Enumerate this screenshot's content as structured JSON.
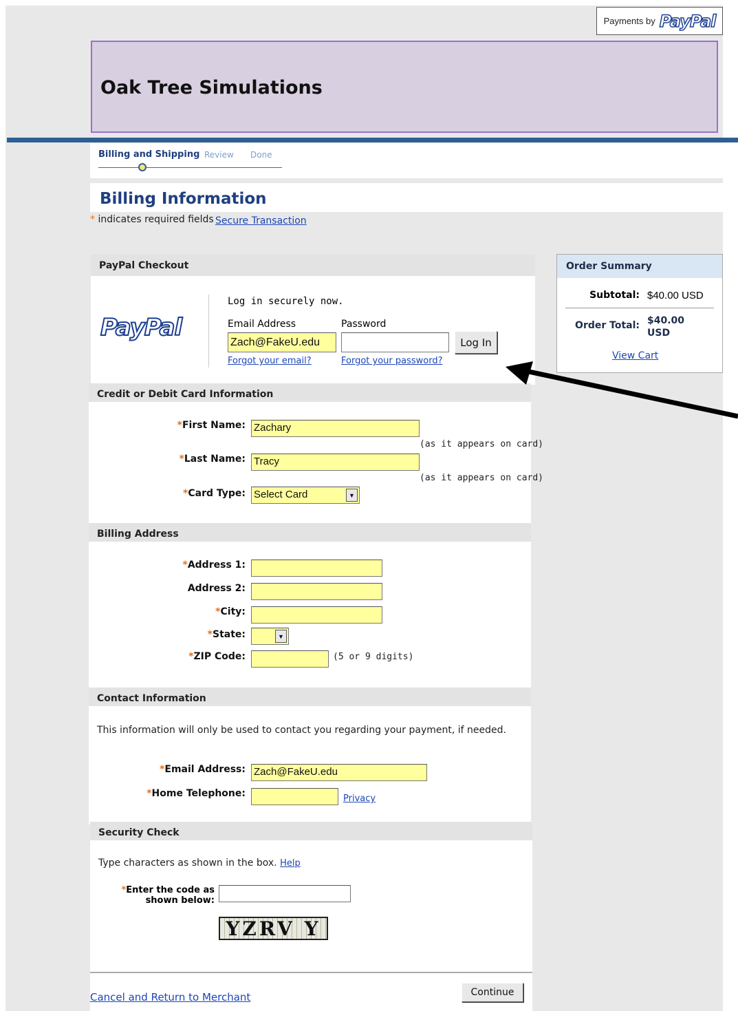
{
  "badge": {
    "prefix": "Payments by",
    "logo": "PayPal"
  },
  "merchant": {
    "name": "Oak Tree Simulations"
  },
  "steps": [
    {
      "label": "Billing and Shipping",
      "active": true
    },
    {
      "label": "Review"
    },
    {
      "label": "Done"
    }
  ],
  "billing": {
    "title": "Billing Information",
    "required_star": "*",
    "required_note": " indicates required fields",
    "secure_link": "Secure Transaction"
  },
  "paypal_checkout": {
    "header": "PayPal Checkout",
    "logo": "PayPal",
    "intro": "Log in securely now.",
    "email_label": "Email Address",
    "email_value": "Zach@FakeU.edu",
    "password_label": "Password",
    "password_value": "",
    "login_button": "Log In",
    "forgot_email": "Forgot your email?",
    "forgot_password": "Forgot your password?"
  },
  "card": {
    "header": "Credit or Debit Card Information",
    "first_name_label": "First Name:",
    "first_name_value": "Zachary",
    "last_name_label": "Last Name:",
    "last_name_value": "Tracy",
    "as_appears": "(as it appears on card)",
    "card_type_label": "Card Type:",
    "card_type_value": "Select Card"
  },
  "address": {
    "header": "Billing Address",
    "address1_label": "Address 1:",
    "address2_label": "Address 2:",
    "city_label": "City:",
    "state_label": "State:",
    "zip_label": "ZIP Code:",
    "zip_hint": "(5 or 9 digits)"
  },
  "contact": {
    "header": "Contact Information",
    "note": "This information will only be used to contact you regarding your payment, if needed.",
    "email_label": "Email Address:",
    "email_value": "Zach@FakeU.edu",
    "phone_label": "Home Telephone:",
    "privacy_link": "Privacy"
  },
  "security": {
    "header": "Security Check",
    "instruction": "Type characters as shown in the box.",
    "help_link": "Help",
    "code_label_1": "Enter the code as",
    "code_label_2": "shown below:",
    "captcha_text": "YZRV Y"
  },
  "footer": {
    "cancel_link": "Cancel and Return to Merchant",
    "continue_button": "Continue"
  },
  "order_summary": {
    "header": "Order Summary",
    "subtotal_label": "Subtotal:",
    "subtotal_value": "$40.00 USD",
    "total_label": "Order Total:",
    "total_value_1": "$40.00",
    "total_value_2": "USD",
    "view_cart": "View Cart"
  },
  "colors": {
    "brand": "#1c3f91",
    "accent": "#2d5f93",
    "field": "#ffff9e",
    "required": "#e8701a"
  },
  "annotation": {
    "icon": "pointer-arrow-icon"
  }
}
